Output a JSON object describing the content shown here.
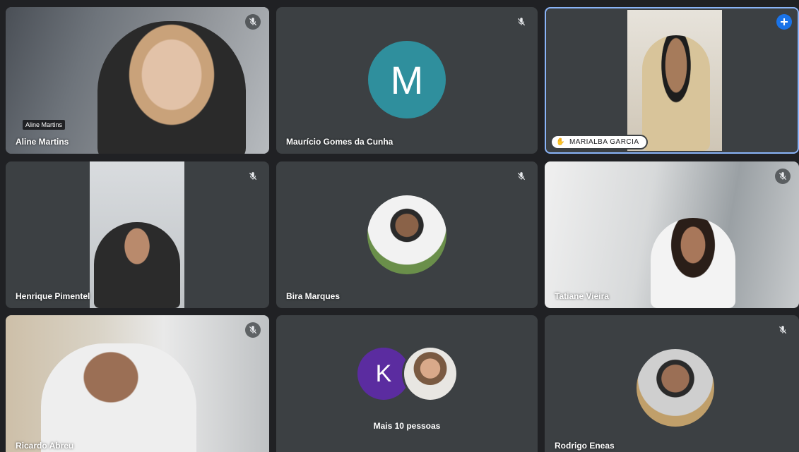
{
  "participants": {
    "aline": {
      "name": "Aline Martins",
      "tooltip": "Aline Martins"
    },
    "mauricio": {
      "name": "Maurício Gomes da Cunha",
      "initial": "M"
    },
    "marialba": {
      "name": "MARIALBA GARCIA"
    },
    "henrique": {
      "name": "Henrique Pimentel"
    },
    "bira": {
      "name": "Bira Marques"
    },
    "tatiane": {
      "name": "Tatiane Vieira"
    },
    "ricardo": {
      "name": "Ricardo Abreu"
    },
    "more": {
      "label": "Mais 10 pessoas",
      "initial": "K"
    },
    "rodrigo": {
      "name": "Rodrigo Eneas"
    }
  },
  "colors": {
    "tile_bg": "#3c4043",
    "page_bg": "#202124",
    "avatar_m": "#2f8f9d",
    "avatar_k": "#5b2ca0",
    "pin_blue": "#1a73e8",
    "active_border": "#8ab4f8"
  },
  "icons": {
    "muted": "mic-off-icon",
    "pin": "pin-icon",
    "presenter": "hand-icon"
  }
}
